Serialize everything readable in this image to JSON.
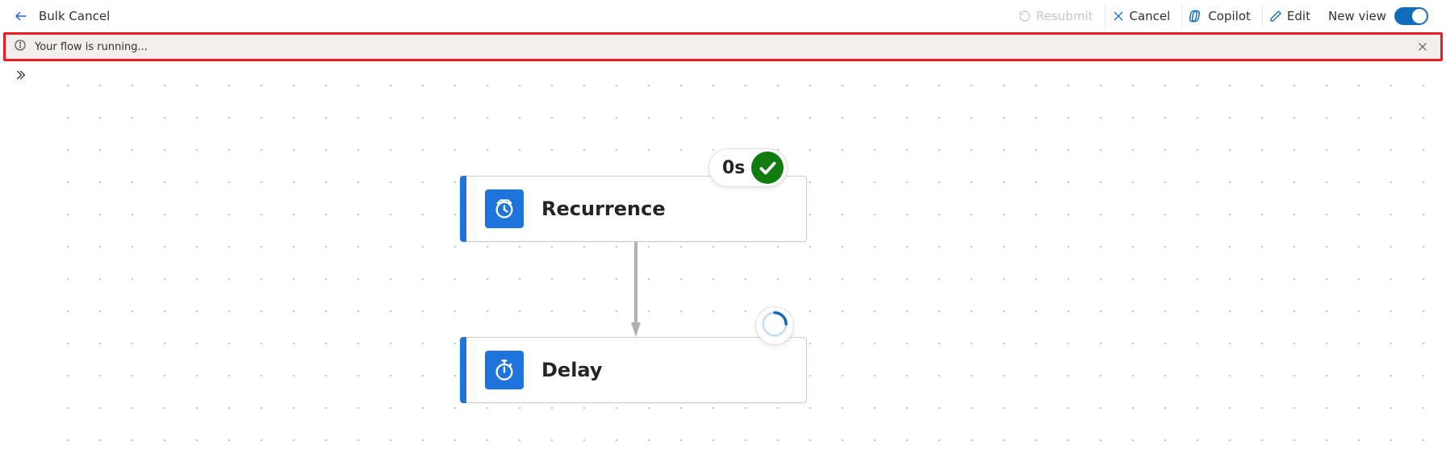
{
  "header": {
    "title": "Bulk Cancel",
    "actions": {
      "resubmit": "Resubmit",
      "cancel": "Cancel",
      "copilot": "Copilot",
      "edit": "Edit",
      "new_view": "New view"
    }
  },
  "notification": {
    "message": "Your flow is running..."
  },
  "flow": {
    "node1": {
      "title": "Recurrence",
      "duration": "0s"
    },
    "node2": {
      "title": "Delay"
    }
  }
}
